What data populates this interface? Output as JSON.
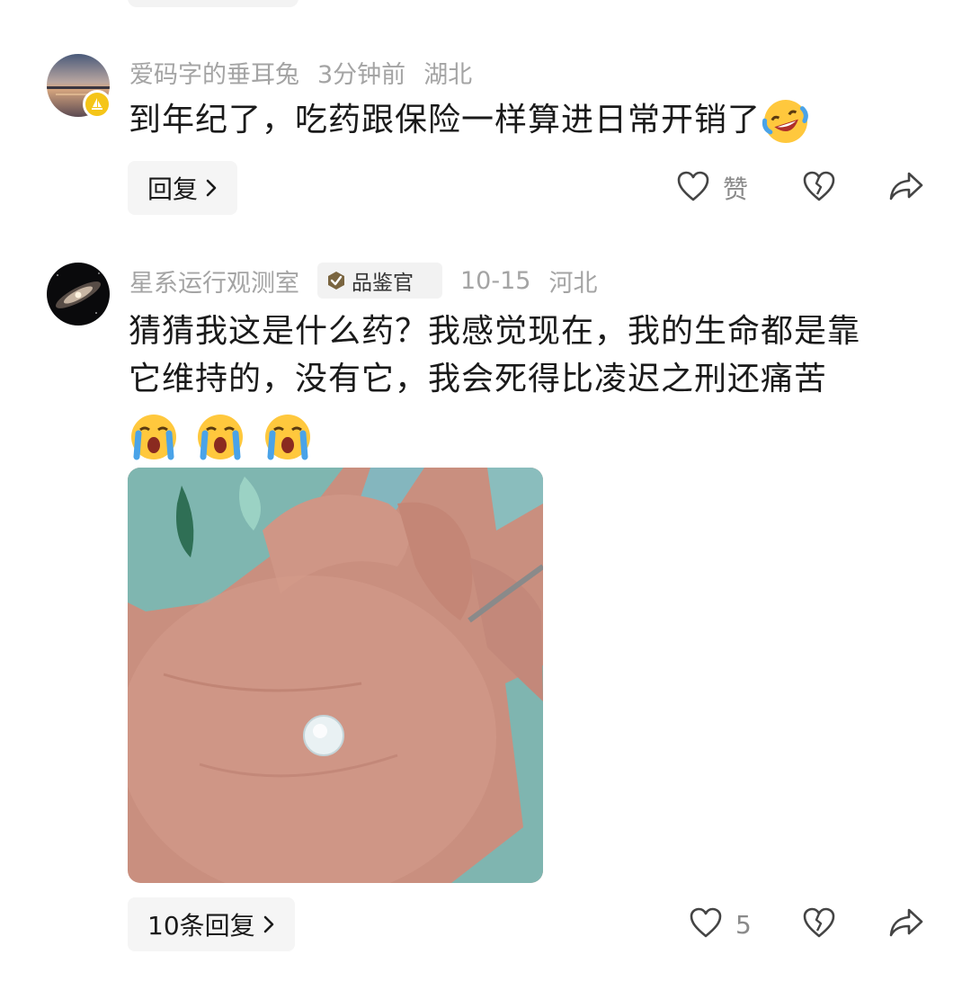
{
  "comments": [
    {
      "author": "爱码字的垂耳兔",
      "time": "3分钟前",
      "location": "湖北",
      "text": "到年纪了，吃药跟保险一样算进日常开销了",
      "reply_label": "回复",
      "like_label": "赞"
    },
    {
      "author": "星系运行观测室",
      "badge": "品鉴官",
      "time": "10-15",
      "location": "河北",
      "text_line1": "猜猜我这是什么药？我感觉现在，我的生命都是靠",
      "text_line2": "它维持的，没有它，我会死得比凌迟之刑还痛苦",
      "reply_label": "10条回复",
      "like_count": "5"
    }
  ],
  "icons": {
    "like": "heart-outline-icon",
    "dislike": "broken-heart-icon",
    "share": "share-arrow-icon",
    "chevron": "chevron-right-icon",
    "emoji_laugh": "laughing-tears-emoji",
    "emoji_cry": "loudly-crying-emoji"
  },
  "colors": {
    "meta_text": "#a4a4a4",
    "badge_gold": "#f5c518",
    "reply_bg": "#f5f5f5"
  }
}
